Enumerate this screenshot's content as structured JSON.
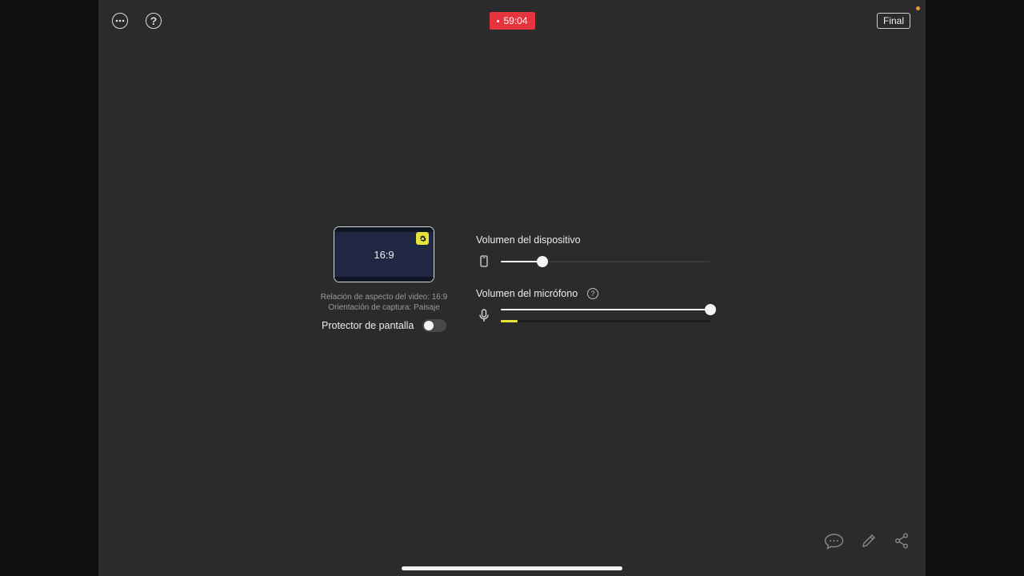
{
  "topbar": {
    "more_icon": "ellipsis-circle-icon",
    "help_label": "?",
    "timer": "59:04",
    "final_label": "Final"
  },
  "preview": {
    "ratio": "16:9",
    "gear_icon": "gear-icon",
    "aspect_text": "Relación de aspecto del video: 16:9",
    "orientation_text": "Orientación de captura: Paisaje"
  },
  "screen_protector": {
    "label": "Protector de pantalla",
    "enabled": false
  },
  "device_volume": {
    "label": "Volumen del dispositivo",
    "icon": "phone-icon",
    "value": 0.2
  },
  "mic_volume": {
    "label": "Volumen del micrófono",
    "help": "?",
    "icon": "microphone-icon",
    "value": 1.0,
    "level": 0.08
  },
  "bottom_actions": {
    "comment_icon": "comment-icon",
    "pencil_icon": "pencil-icon",
    "share_icon": "share-icon"
  },
  "colors": {
    "accent_yellow": "#e4e43a",
    "recording_red": "#e5343e",
    "background": "#2b2b2d"
  }
}
